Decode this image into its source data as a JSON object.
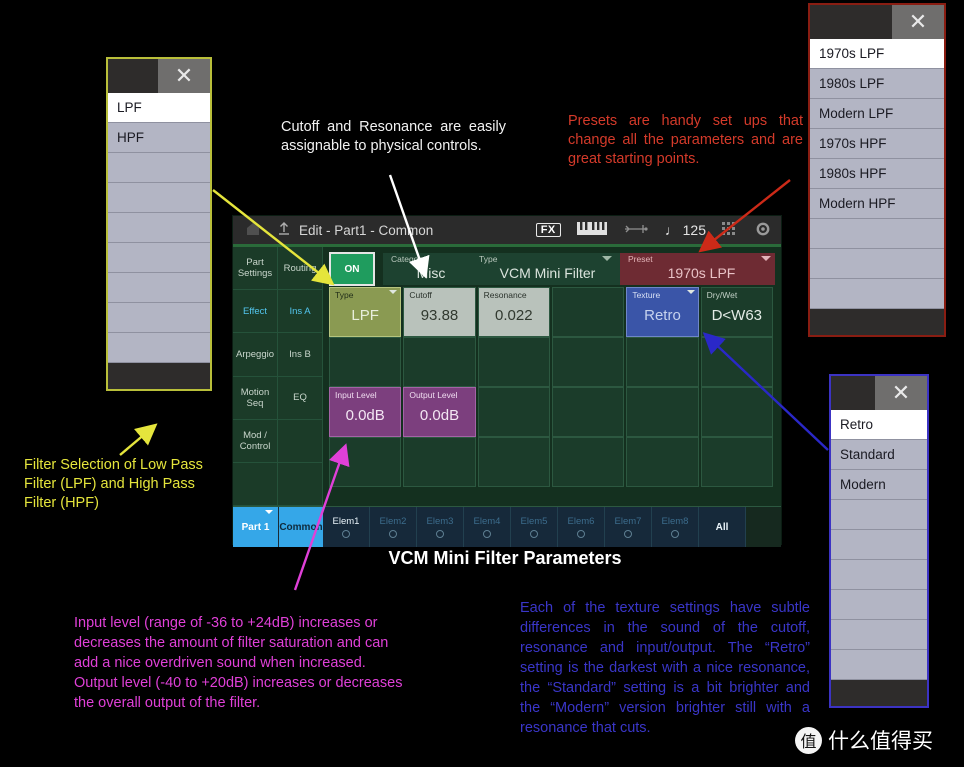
{
  "filter_dropdown": {
    "close_icon": "close-icon",
    "items": [
      "LPF",
      "HPF",
      "",
      "",
      "",
      "",
      "",
      "",
      ""
    ],
    "selected_index": 0
  },
  "preset_dropdown": {
    "close_icon": "close-icon",
    "items": [
      "1970s LPF",
      "1980s LPF",
      "Modern LPF",
      "1970s HPF",
      "1980s HPF",
      "Modern HPF",
      "",
      "",
      ""
    ],
    "selected_index": 0
  },
  "texture_dropdown": {
    "close_icon": "close-icon",
    "items": [
      "Retro",
      "Standard",
      "Modern",
      "",
      "",
      "",
      "",
      "",
      ""
    ],
    "selected_index": 0
  },
  "synth": {
    "topbar": {
      "home_icon": "home-icon",
      "up_icon": "exit-up-icon",
      "breadcrumb": "Edit - Part1 - Common",
      "fx_badge": "FX",
      "keyboard_icon": "keyboard-icon",
      "usb_icon": "usb-icon",
      "tempo": "♩ 125",
      "grid_icon": "grid-icon",
      "gear_icon": "gear-icon"
    },
    "nav_left": [
      "Part Settings",
      "Effect",
      "Arpeggio",
      "Motion Seq",
      "Mod / Control",
      ""
    ],
    "nav_left_active": 1,
    "nav_right": [
      "Routing",
      "Ins A",
      "Ins B",
      "EQ",
      "",
      ""
    ],
    "nav_right_active": 1,
    "on_button": "ON",
    "category": {
      "label": "Category",
      "value": "Misc"
    },
    "type_select": {
      "label": "Type",
      "value": "VCM Mini Filter"
    },
    "preset": {
      "label": "Preset",
      "value": "1970s LPF"
    },
    "params_row1": [
      {
        "label": "Type",
        "value": "LPF",
        "style": "olive",
        "dropdown": true
      },
      {
        "label": "Cutoff",
        "value": "93.88",
        "style": "grey"
      },
      {
        "label": "Resonance",
        "value": "0.022",
        "style": "grey"
      },
      {
        "label": "",
        "value": "",
        "style": "empty"
      },
      {
        "label": "Texture",
        "value": "Retro",
        "style": "blue",
        "dropdown": true
      },
      {
        "label": "Dry/Wet",
        "value": "D<W63",
        "style": "empty"
      }
    ],
    "params_row2": [
      {
        "label": "",
        "value": "",
        "style": "empty"
      },
      {
        "label": "",
        "value": "",
        "style": "empty"
      },
      {
        "label": "",
        "value": "",
        "style": "empty"
      },
      {
        "label": "",
        "value": "",
        "style": "empty"
      },
      {
        "label": "",
        "value": "",
        "style": "empty"
      },
      {
        "label": "",
        "value": "",
        "style": "empty"
      }
    ],
    "params_row3": [
      {
        "label": "Input Level",
        "value": "0.0dB",
        "style": "purple"
      },
      {
        "label": "Output Level",
        "value": "0.0dB",
        "style": "purple"
      },
      {
        "label": "",
        "value": "",
        "style": "empty"
      },
      {
        "label": "",
        "value": "",
        "style": "empty"
      },
      {
        "label": "",
        "value": "",
        "style": "empty"
      },
      {
        "label": "",
        "value": "",
        "style": "empty"
      }
    ],
    "params_row4": [
      {
        "label": "",
        "value": "",
        "style": "empty"
      },
      {
        "label": "",
        "value": "",
        "style": "empty"
      },
      {
        "label": "",
        "value": "",
        "style": "empty"
      },
      {
        "label": "",
        "value": "",
        "style": "empty"
      },
      {
        "label": "",
        "value": "",
        "style": "empty"
      },
      {
        "label": "",
        "value": "",
        "style": "empty"
      }
    ],
    "bottom": {
      "part": "Part 1",
      "common": "Common",
      "elements": [
        "Elem1",
        "Elem2",
        "Elem3",
        "Elem4",
        "Elem5",
        "Elem6",
        "Elem7",
        "Elem8"
      ],
      "element_active": 0,
      "all": "All"
    }
  },
  "annotations": {
    "cutoff_note": "Cutoff and Resonance are easily assignable to physical controls.",
    "preset_note": "Presets are handy set ups that change all the parameters and are great starting points.",
    "filter_note": "Filter Selection of Low Pass Filter (LPF) and High Pass Filter (HPF)",
    "level_note": "Input level (range of -36 to +24dB) increases or decreases the amount of filter saturation and can add a nice overdriven sound when increased. Output level (-40 to +20dB) increases or decreases the overall output of the filter.",
    "texture_note": "Each of the texture settings have subtle differences in the sound of the cutoff, resonance and input/output. The “Retro” setting is the darkest with a nice resonance, the “Standard” setting is a bit brighter and the “Modern” version brighter still with a resonance that cuts."
  },
  "caption": "VCM Mini Filter Parameters",
  "watermark": {
    "mark": "值",
    "text": "什么值得买"
  },
  "colors": {
    "yellow_arrow": "#e5e53c",
    "red_arrow": "#cc2a18",
    "white_arrow": "#ffffff",
    "magenta_arrow": "#e040d8",
    "blue_arrow": "#2a28c8"
  }
}
